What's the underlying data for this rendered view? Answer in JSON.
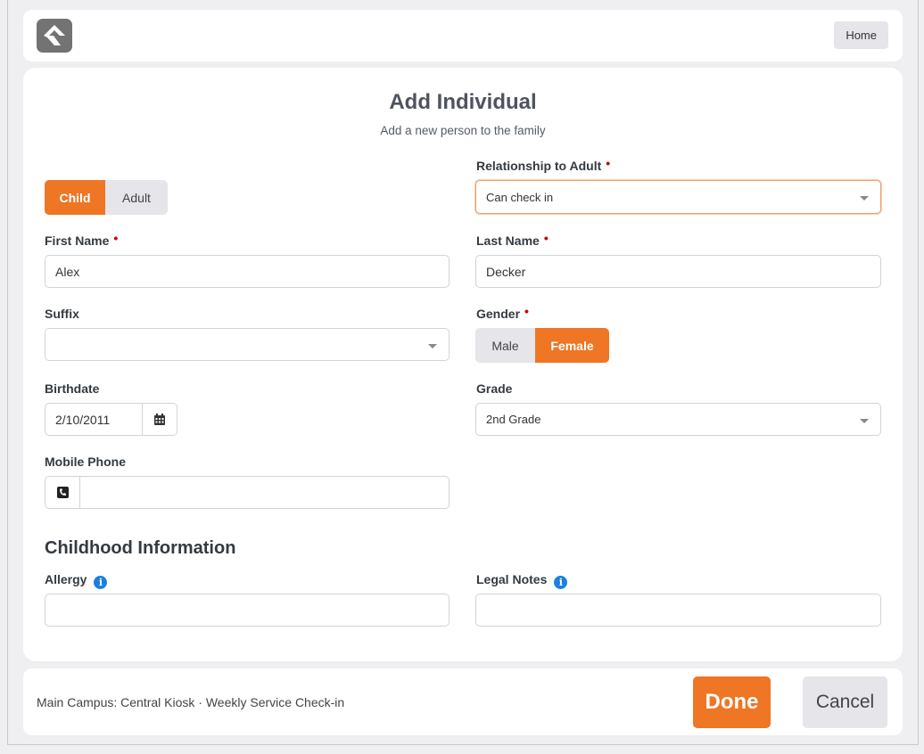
{
  "header": {
    "logo_icon": "rock-logo-icon",
    "home_label": "Home"
  },
  "form": {
    "title": "Add Individual",
    "subtitle": "Add a new person to the family",
    "person_type": {
      "options": [
        "Child",
        "Adult"
      ],
      "selected": "Child"
    },
    "relationship": {
      "label": "Relationship to Adult",
      "value": "Can check in"
    },
    "first_name": {
      "label": "First Name",
      "value": "Alex"
    },
    "last_name": {
      "label": "Last Name",
      "value": "Decker"
    },
    "suffix": {
      "label": "Suffix",
      "value": ""
    },
    "gender": {
      "label": "Gender",
      "options": [
        "Male",
        "Female"
      ],
      "selected": "Female"
    },
    "birthdate": {
      "label": "Birthdate",
      "value": "2/10/2011",
      "icon": "calendar-icon"
    },
    "grade": {
      "label": "Grade",
      "value": "2nd Grade"
    },
    "mobile_phone": {
      "label": "Mobile Phone",
      "value": "",
      "icon": "phone-icon"
    },
    "childhood": {
      "title": "Childhood Information",
      "allergy": {
        "label": "Allergy",
        "value": ""
      },
      "legal_notes": {
        "label": "Legal Notes",
        "value": ""
      }
    }
  },
  "footer": {
    "location": "Main Campus: Central Kiosk · Weekly Service Check-in",
    "done_label": "Done",
    "cancel_label": "Cancel"
  },
  "colors": {
    "accent": "#ee7624",
    "required": "#cc0000",
    "info": "#1c7fe0"
  }
}
